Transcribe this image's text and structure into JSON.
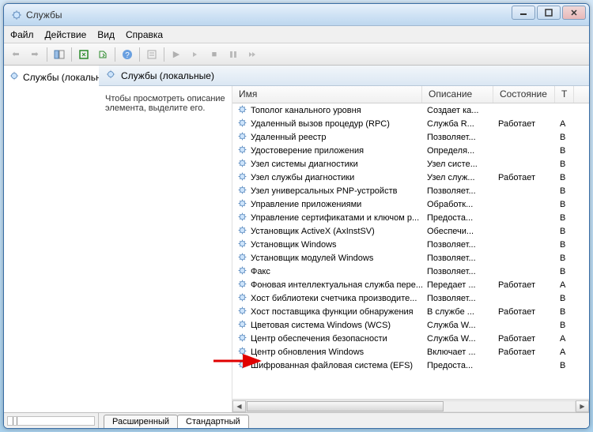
{
  "titlebar": {
    "title": "Службы"
  },
  "menu": {
    "file": "Файл",
    "action": "Действие",
    "view": "Вид",
    "help": "Справка"
  },
  "sidebar": {
    "item": "Службы (локальн"
  },
  "main_header": {
    "title": "Службы (локальные)"
  },
  "detail": {
    "hint": "Чтобы просмотреть описание элемента, выделите его."
  },
  "columns": {
    "name": "Имя",
    "desc": "Описание",
    "state": "Состояние",
    "t": "Т"
  },
  "tabs": {
    "extended": "Расширенный",
    "standard": "Стандартный"
  },
  "services": [
    {
      "name": "Тополог канального уровня",
      "desc": "Создает ка...",
      "state": "",
      "t": ""
    },
    {
      "name": "Удаленный вызов процедур (RPC)",
      "desc": "Служба R...",
      "state": "Работает",
      "t": "А"
    },
    {
      "name": "Удаленный реестр",
      "desc": "Позволяет...",
      "state": "",
      "t": "В"
    },
    {
      "name": "Удостоверение приложения",
      "desc": "Определя...",
      "state": "",
      "t": "В"
    },
    {
      "name": "Узел системы диагностики",
      "desc": "Узел систе...",
      "state": "",
      "t": "В"
    },
    {
      "name": "Узел службы диагностики",
      "desc": "Узел служ...",
      "state": "Работает",
      "t": "В"
    },
    {
      "name": "Узел универсальных PNP-устройств",
      "desc": "Позволяет...",
      "state": "",
      "t": "В"
    },
    {
      "name": "Управление приложениями",
      "desc": "Обработк...",
      "state": "",
      "t": "В"
    },
    {
      "name": "Управление сертификатами и ключом р...",
      "desc": "Предоста...",
      "state": "",
      "t": "В"
    },
    {
      "name": "Установщик ActiveX (AxInstSV)",
      "desc": "Обеспечи...",
      "state": "",
      "t": "В"
    },
    {
      "name": "Установщик Windows",
      "desc": "Позволяет...",
      "state": "",
      "t": "В"
    },
    {
      "name": "Установщик модулей Windows",
      "desc": "Позволяет...",
      "state": "",
      "t": "В"
    },
    {
      "name": "Факс",
      "desc": "Позволяет...",
      "state": "",
      "t": "В"
    },
    {
      "name": "Фоновая интеллектуальная служба пере...",
      "desc": "Передает ...",
      "state": "Работает",
      "t": "А"
    },
    {
      "name": "Хост библиотеки счетчика производите...",
      "desc": "Позволяет...",
      "state": "",
      "t": "В"
    },
    {
      "name": "Хост поставщика функции обнаружения",
      "desc": "В службе ...",
      "state": "Работает",
      "t": "В"
    },
    {
      "name": "Цветовая система Windows (WCS)",
      "desc": "Служба W...",
      "state": "",
      "t": "В"
    },
    {
      "name": "Центр обеспечения безопасности",
      "desc": "Служба W...",
      "state": "Работает",
      "t": "А"
    },
    {
      "name": "Центр обновления Windows",
      "desc": "Включает ...",
      "state": "Работает",
      "t": "А"
    },
    {
      "name": "Шифрованная файловая система (EFS)",
      "desc": "Предоста...",
      "state": "",
      "t": "В"
    }
  ]
}
